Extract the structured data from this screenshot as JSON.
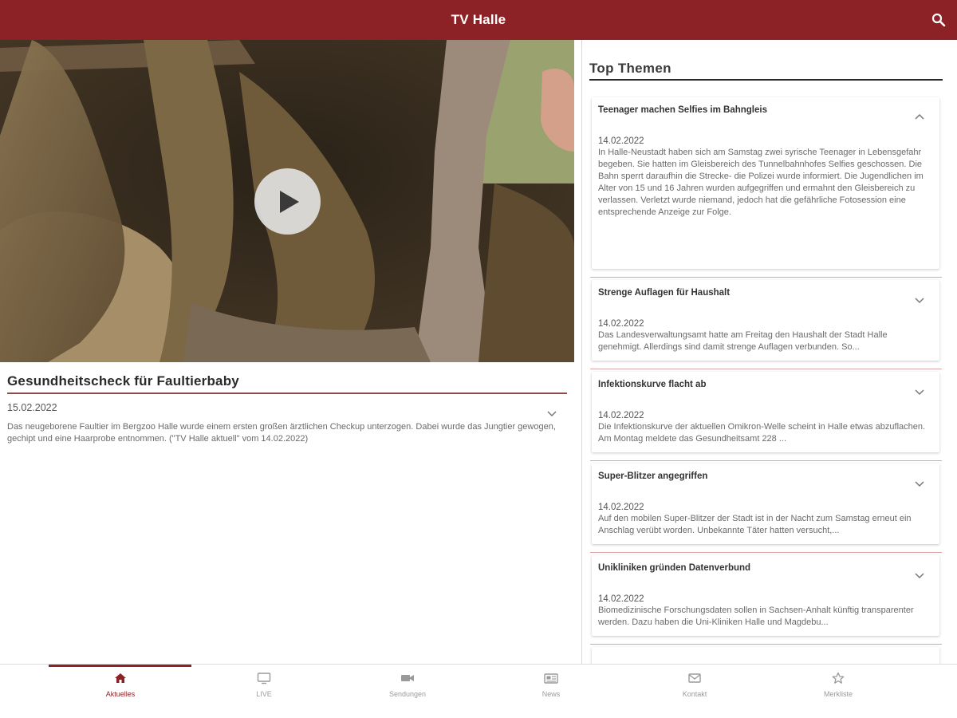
{
  "app": {
    "title": "TV Halle",
    "accent": "#8d2226"
  },
  "featured": {
    "title": "Gesundheitscheck für Faultierbaby",
    "date": "15.02.2022",
    "text": "Das neugeborene Faultier im Bergzoo Halle wurde einem ersten großen ärztlichen Checkup unterzogen. Dabei wurde das Jungtier gewogen, gechipt und eine Haarprobe entnommen. (\"TV Halle aktuell\" vom 14.02.2022)"
  },
  "top_topics": {
    "heading": "Top Themen",
    "items": [
      {
        "title": "Teenager machen Selfies im Bahngleis",
        "date": "14.02.2022",
        "text": "In Halle-Neustadt haben sich am Samstag zwei syrische Teenager in Lebensgefahr begeben. Sie hatten im Gleisbereich des Tunnelbahnhofes Selfies geschossen. Die Bahn sperrt daraufhin die Strecke- die Polizei wurde informiert. Die Jugendlichen im Alter von 15 und 16 Jahren wurden aufgegriffen und ermahnt den Gleisbereich zu verlassen. Verletzt wurde niemand, jedoch hat die gefährliche Fotosession eine entsprechende Anzeige zur Folge.",
        "expanded": true
      },
      {
        "title": "Strenge Auflagen für Haushalt",
        "date": "14.02.2022",
        "text": "Das Landesverwaltungsamt hatte am Freitag den Haushalt der Stadt Halle genehmigt. Allerdings sind damit strenge Auflagen verbunden. So...",
        "expanded": false
      },
      {
        "title": "Infektionskurve flacht ab",
        "date": "14.02.2022",
        "text": "Die Infektionskurve der aktuellen Omikron-Welle scheint in Halle etwas abzuflachen. Am Montag meldete das Gesundheitsamt 228 ...",
        "expanded": false
      },
      {
        "title": "Super-Blitzer angegriffen",
        "date": "14.02.2022",
        "text": "Auf den mobilen Super-Blitzer der Stadt ist in der Nacht zum Samstag erneut ein Anschlag verübt worden. Unbekannte Täter hatten versucht,...",
        "expanded": false
      },
      {
        "title": "Unikliniken gründen Datenverbund",
        "date": "14.02.2022",
        "text": "Biomedizinische Forschungsdaten sollen in Sachsen-Anhalt künftig transparenter werden. Dazu haben die Uni-Kliniken Halle und Magdebu...",
        "expanded": false
      }
    ]
  },
  "bottom_nav": {
    "items": [
      {
        "label": "Aktuelles",
        "icon": "home-icon",
        "active": true
      },
      {
        "label": "LIVE",
        "icon": "tv-icon",
        "active": false
      },
      {
        "label": "Sendungen",
        "icon": "video-camera-icon",
        "active": false
      },
      {
        "label": "News",
        "icon": "newspaper-icon",
        "active": false
      },
      {
        "label": "Kontakt",
        "icon": "mail-icon",
        "active": false
      },
      {
        "label": "Merkliste",
        "icon": "star-icon",
        "active": false
      }
    ]
  }
}
